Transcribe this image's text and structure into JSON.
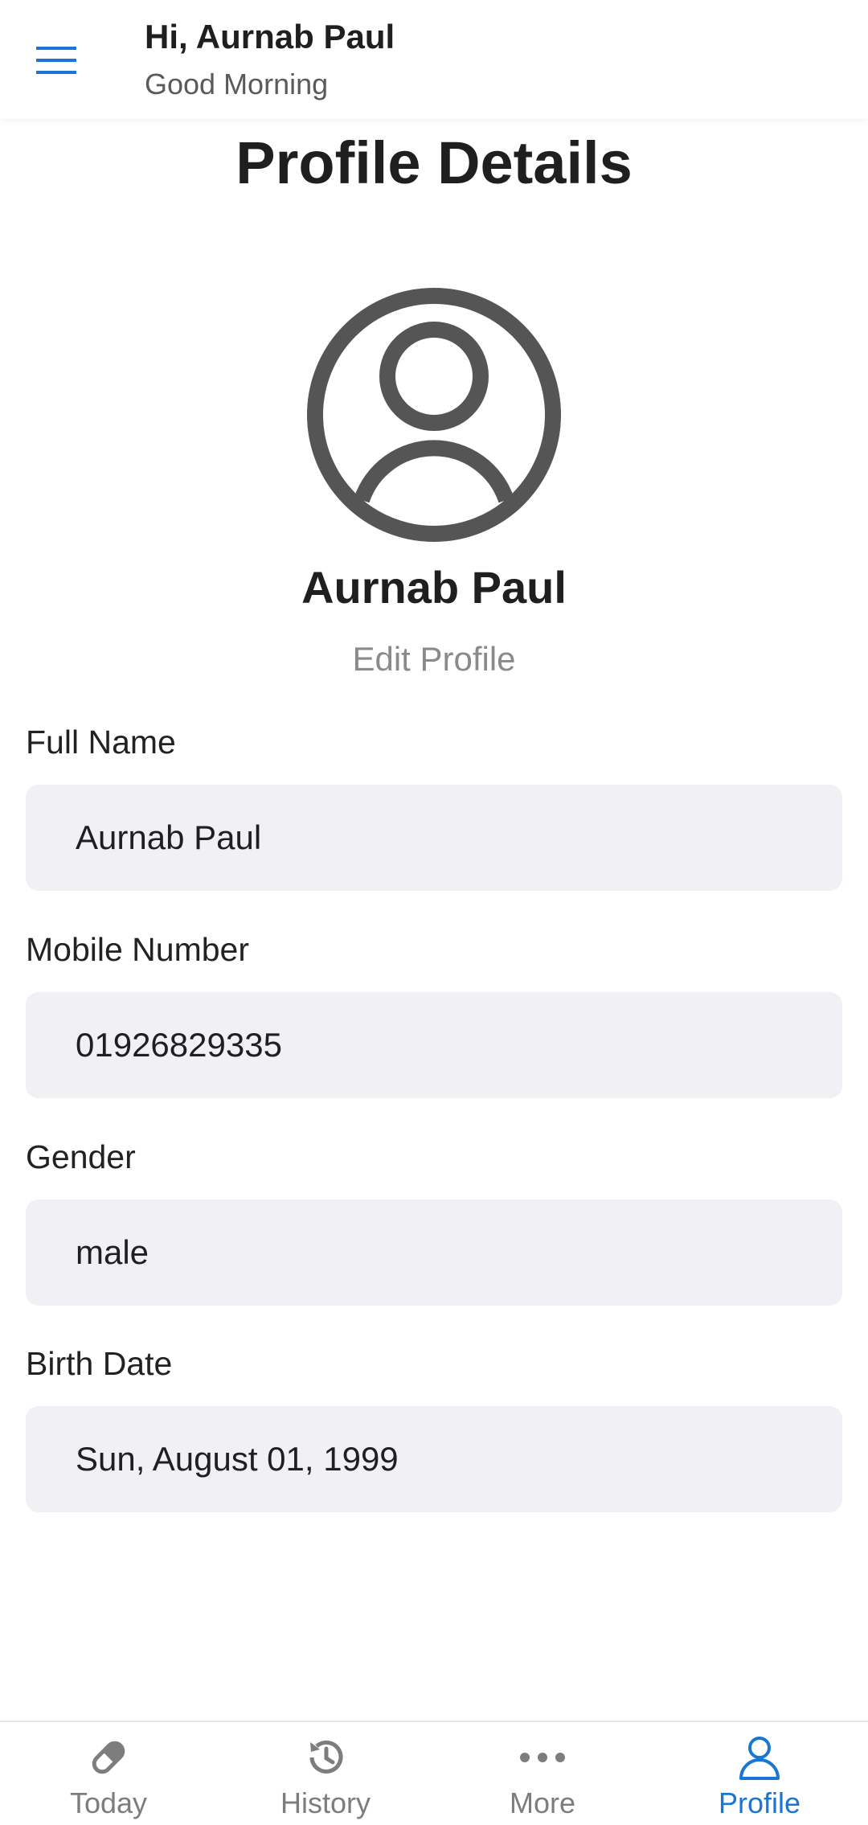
{
  "header": {
    "greeting": "Hi, Aurnab Paul",
    "subtitle": "Good Morning"
  },
  "page": {
    "title": "Profile Details",
    "profile_name": "Aurnab Paul",
    "edit_label": "Edit Profile"
  },
  "fields": [
    {
      "label": "Full Name",
      "value": "Aurnab Paul"
    },
    {
      "label": "Mobile Number",
      "value": "01926829335"
    },
    {
      "label": "Gender",
      "value": "male"
    },
    {
      "label": "Birth Date",
      "value": "Sun, August 01, 1999"
    }
  ],
  "nav": {
    "items": [
      {
        "label": "Today",
        "icon": "pill-icon"
      },
      {
        "label": "History",
        "icon": "history-icon"
      },
      {
        "label": "More",
        "icon": "more-icon"
      },
      {
        "label": "Profile",
        "icon": "person-icon",
        "active": true
      }
    ]
  },
  "colors": {
    "accent": "#1976d2",
    "icon_gray": "#555555",
    "field_bg": "#f0f0f5"
  }
}
